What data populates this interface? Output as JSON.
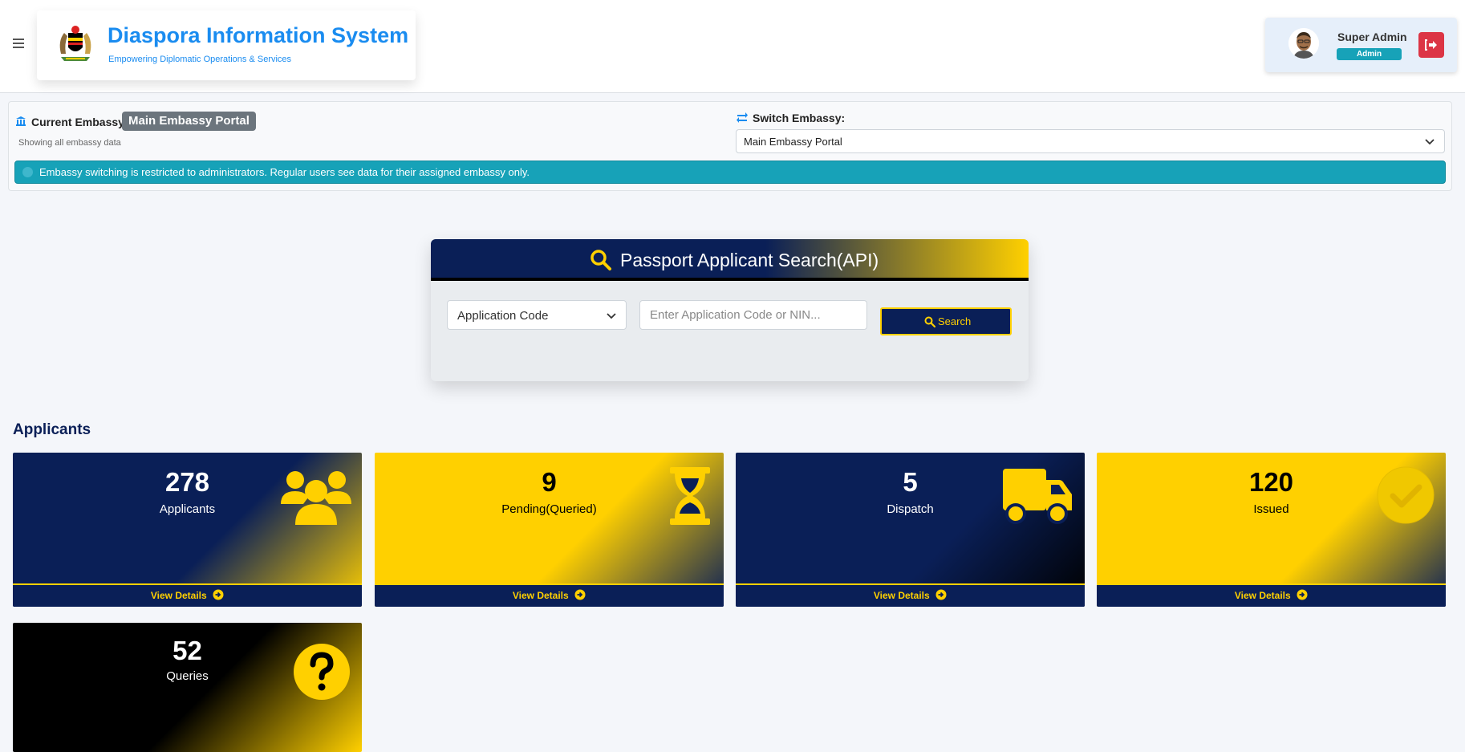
{
  "header": {
    "brand_title": "Diaspora Information System",
    "brand_subtitle": "Empowering Diplomatic Operations & Services",
    "user_name": "Super Admin",
    "user_role": "Admin"
  },
  "embassy": {
    "current_label": "Current Embassy:",
    "current_value": "Main Embassy Portal",
    "showing_text": "Showing all embassy data",
    "switch_label": "Switch Embassy:",
    "switch_selected": "Main Embassy Portal",
    "notice": "Embassy switching is restricted to administrators. Regular users see data for their assigned embassy only."
  },
  "search": {
    "title": "Passport Applicant Search(API)",
    "type_selected": "Application Code",
    "input_placeholder": "Enter Application Code or NIN...",
    "button_label": "Search"
  },
  "applicants": {
    "section_title": "Applicants",
    "cards": [
      {
        "count": "278",
        "label": "Applicants",
        "icon": "users-icon",
        "footer": "View Details"
      },
      {
        "count": "9",
        "label": "Pending(Queried)",
        "icon": "hourglass-icon",
        "footer": "View Details"
      },
      {
        "count": "5",
        "label": "Dispatch",
        "icon": "truck-icon",
        "footer": "View Details"
      },
      {
        "count": "120",
        "label": "Issued",
        "icon": "check-circle-icon",
        "footer": "View Details"
      },
      {
        "count": "52",
        "label": "Queries",
        "icon": "question-circle-icon",
        "footer": ""
      }
    ]
  },
  "colors": {
    "navy": "#0a1f57",
    "gold": "#ffd000",
    "brand_blue": "#1a8cf0",
    "info": "#17a2b8",
    "danger": "#dc3545"
  }
}
